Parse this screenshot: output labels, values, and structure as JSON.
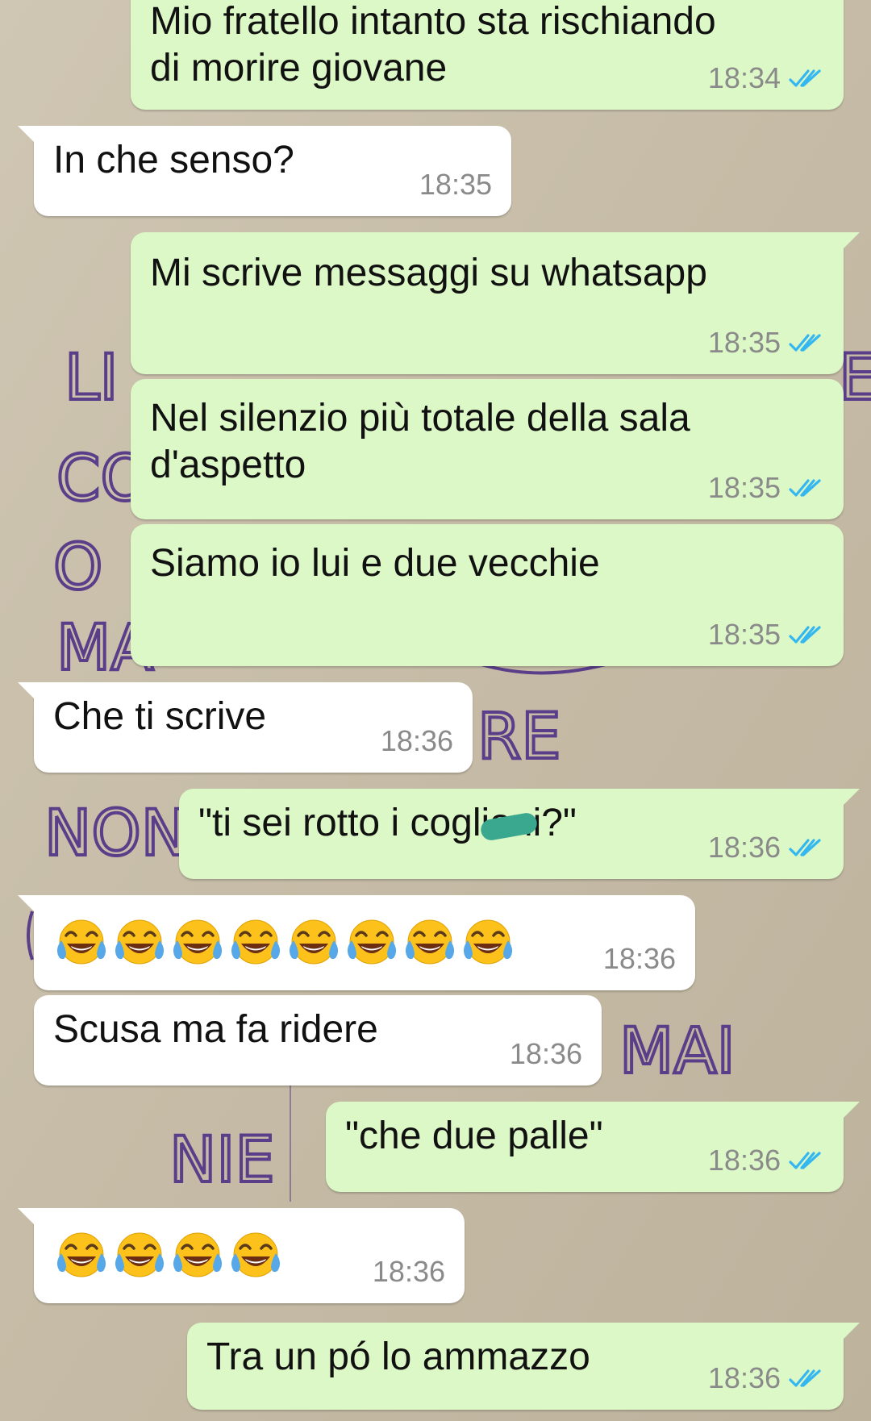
{
  "theme": {
    "outgoing_bubble": "#dcf8c6",
    "incoming_bubble": "#ffffff",
    "timestamp_color": "#8a8a8a",
    "read_ticks_color": "#34b7f1",
    "wallpaper_color": "#c9c0ad",
    "wallpaper_marker_color": "#5a3e8a"
  },
  "wallpaper": {
    "handwriting": [
      "LI",
      "E",
      "CO",
      "O",
      "MA",
      "RE",
      "NON",
      "MAI",
      "NIE"
    ]
  },
  "messages": [
    {
      "direction": "outgoing",
      "text": "Mio fratello intanto sta rischiando\ndi morire giovane",
      "time": "18:34",
      "status_icon": "double-check-read-icon"
    },
    {
      "direction": "incoming",
      "text": "In che senso?",
      "time": "18:35"
    },
    {
      "direction": "outgoing",
      "text": "Mi scrive messaggi su whatsapp",
      "time": "18:35",
      "status_icon": "double-check-read-icon"
    },
    {
      "direction": "outgoing",
      "text": "Nel silenzio più totale della sala\nd'aspetto",
      "time": "18:35",
      "status_icon": "double-check-read-icon"
    },
    {
      "direction": "outgoing",
      "text": "Siamo io lui e due vecchie",
      "time": "18:35",
      "status_icon": "double-check-read-icon"
    },
    {
      "direction": "incoming",
      "text": "Che ti scrive",
      "time": "18:36"
    },
    {
      "direction": "outgoing",
      "text": "\"ti sei rotto i coglioni?\"",
      "time": "18:36",
      "status_icon": "double-check-read-icon",
      "redaction": "green-scribble-over-text"
    },
    {
      "direction": "incoming",
      "emoji": "face-with-tears-of-joy-icon",
      "emoji_count": 8,
      "time": "18:36"
    },
    {
      "direction": "incoming",
      "text": "Scusa ma fa ridere",
      "time": "18:36"
    },
    {
      "direction": "outgoing",
      "text": "\"che due palle\"",
      "time": "18:36",
      "status_icon": "double-check-read-icon"
    },
    {
      "direction": "incoming",
      "emoji": "face-with-tears-of-joy-icon",
      "emoji_count": 4,
      "time": "18:36"
    },
    {
      "direction": "outgoing",
      "text": "Tra un pó lo ammazzo",
      "time": "18:36",
      "status_icon": "double-check-read-icon"
    }
  ]
}
